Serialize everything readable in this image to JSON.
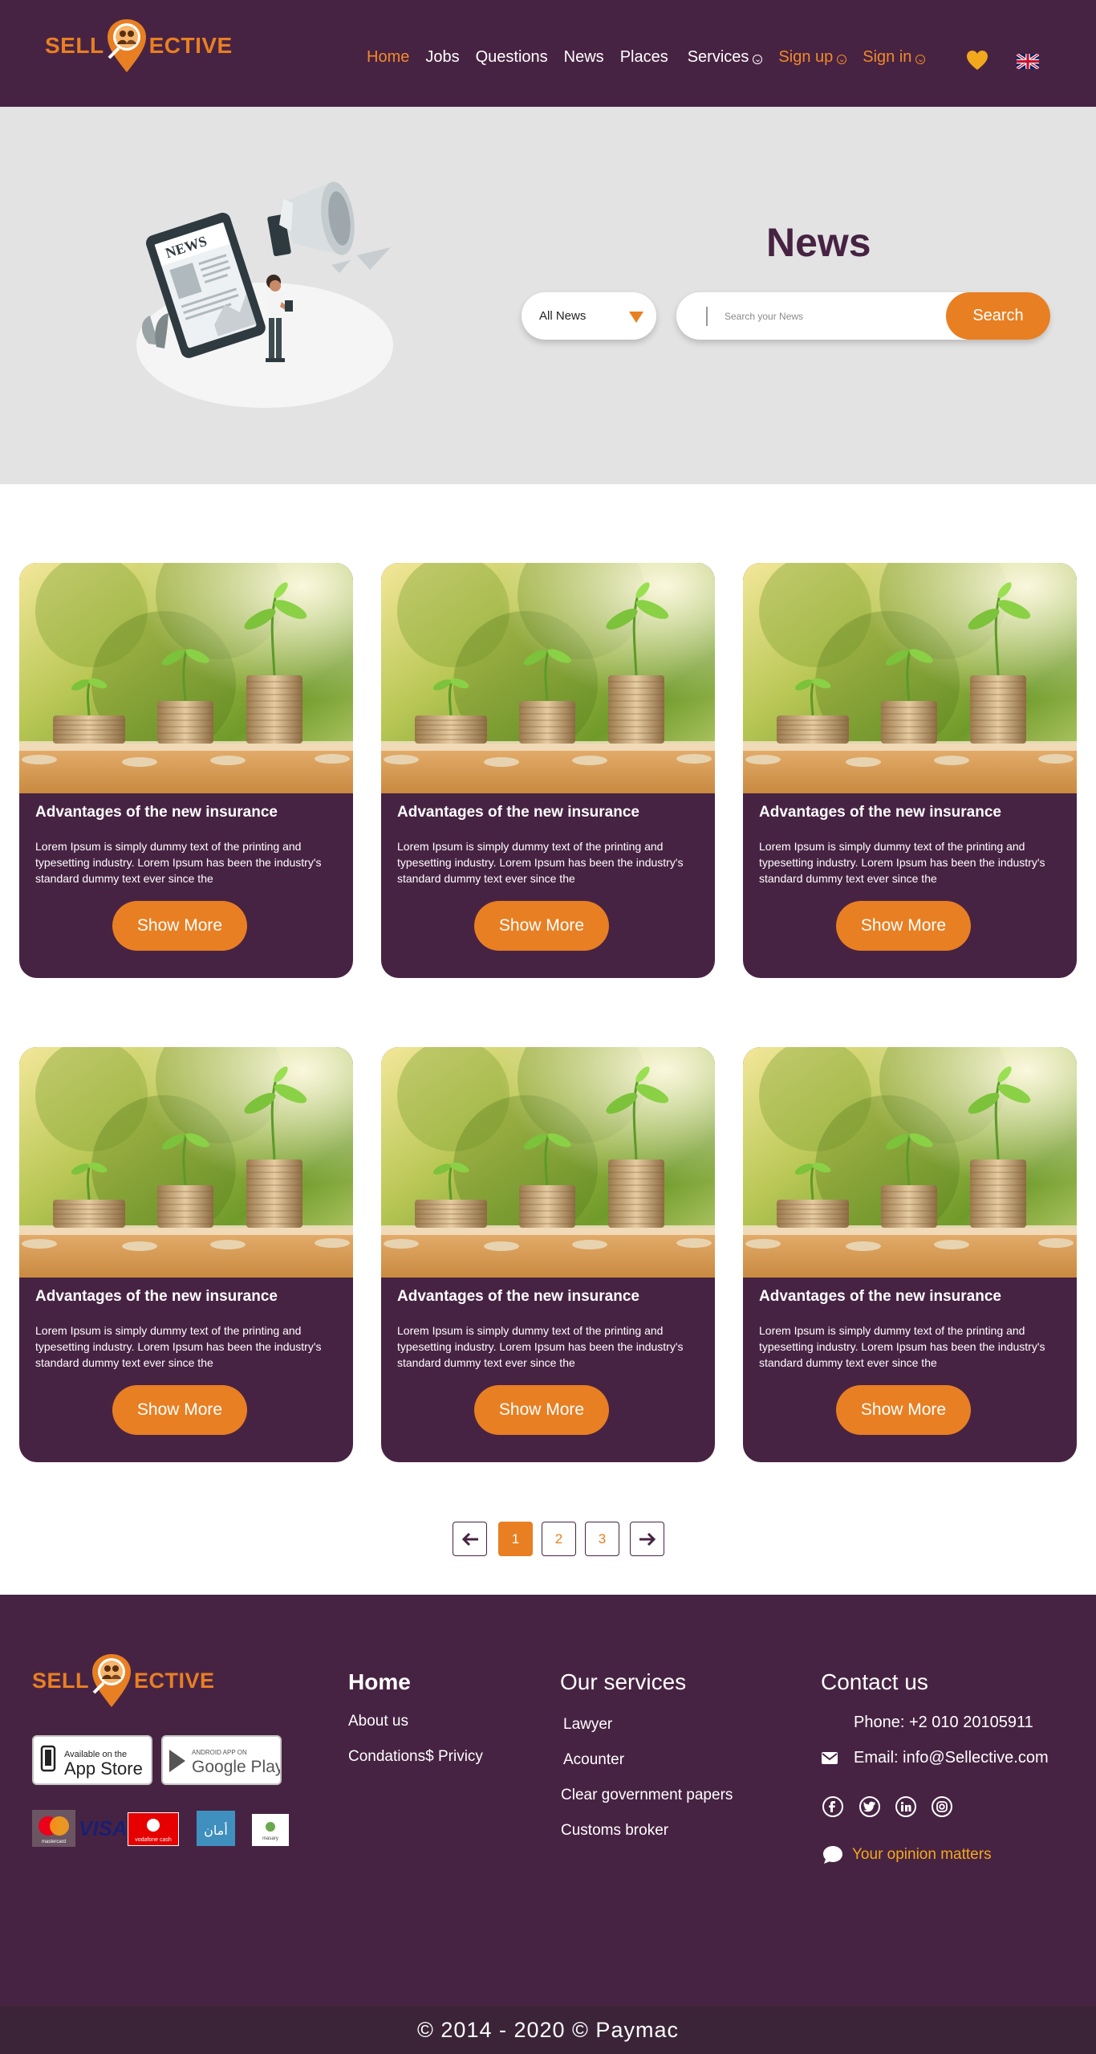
{
  "header": {
    "logo": {
      "left": "SELL",
      "right": "ECTIVE"
    },
    "nav": [
      {
        "label": "Home"
      },
      {
        "label": "Jobs"
      },
      {
        "label": "Questions"
      },
      {
        "label": "News"
      },
      {
        "label": "Places"
      },
      {
        "label": "Services"
      },
      {
        "label": "Sign up"
      },
      {
        "label": "Sign in"
      }
    ],
    "favorites_icon": "heart-icon",
    "language_icon": "uk-flag-icon"
  },
  "hero": {
    "title": "News",
    "illustration_text": "NEWS",
    "filter_value": "All News",
    "search_placeholder": "Search your News",
    "search_button": "Search"
  },
  "cards": [
    {
      "title": "Advantages of the new insurance",
      "description": "Lorem Ipsum is simply dummy text of the printing and typesetting industry. Lorem Ipsum has been the industry's standard dummy text ever since the",
      "button": "Show More"
    },
    {
      "title": "Advantages of the new insurance",
      "description": "Lorem Ipsum is simply dummy text of the printing and typesetting industry. Lorem Ipsum has been the industry's standard dummy text ever since the",
      "button": "Show More"
    },
    {
      "title": "Advantages of the new insurance",
      "description": "Lorem Ipsum is simply dummy text of the printing and typesetting industry. Lorem Ipsum has been the industry's standard dummy text ever since the",
      "button": "Show More"
    },
    {
      "title": "Advantages of the new insurance",
      "description": "Lorem Ipsum is simply dummy text of the printing and typesetting industry. Lorem Ipsum has been the industry's standard dummy text ever since the",
      "button": "Show More"
    },
    {
      "title": "Advantages of the new insurance",
      "description": "Lorem Ipsum is simply dummy text of the printing and typesetting industry. Lorem Ipsum has been the industry's standard dummy text ever since the",
      "button": "Show More"
    },
    {
      "title": "Advantages of the new insurance",
      "description": "Lorem Ipsum is simply dummy text of the printing and typesetting industry. Lorem Ipsum has been the industry's standard dummy text ever since the",
      "button": "Show More"
    }
  ],
  "pagination": {
    "prev": "←",
    "pages": [
      "1",
      "2",
      "3"
    ],
    "current": "1",
    "next": "→"
  },
  "footer": {
    "logo": {
      "left": "SELL",
      "right": "ECTIVE"
    },
    "app_store": {
      "small": "Available on the",
      "big": "App Store"
    },
    "google_play": {
      "small": "ANDROID APP ON",
      "big": "Google Play"
    },
    "payment_logos": [
      "mastercard",
      "VISA",
      "vodafone cash",
      "أمان",
      "masary"
    ],
    "home_col": {
      "title": "Home",
      "links": [
        "About us",
        "Condations$ Privicy"
      ]
    },
    "services_col": {
      "title": "Our services",
      "links": [
        "Lawyer",
        "Acounter",
        "Clear government papers",
        "Customs broker"
      ]
    },
    "contact_col": {
      "title": "Contact us",
      "phone": "Phone: +2 010 20105911",
      "email": "Email: info@Sellective.com",
      "socials": [
        "facebook-icon",
        "twitter-icon",
        "linkedin-icon",
        "instagram-icon"
      ],
      "opinion": "Your opinion matters"
    },
    "copyright": "© 2014 - 2020 © Paymac"
  },
  "colors": {
    "brand_purple": "#472343",
    "brand_orange": "#e87f22",
    "hero_bg": "#e3e3e3",
    "copyright_bg": "#3b2438",
    "opinion_yellow": "#f2a81c"
  }
}
